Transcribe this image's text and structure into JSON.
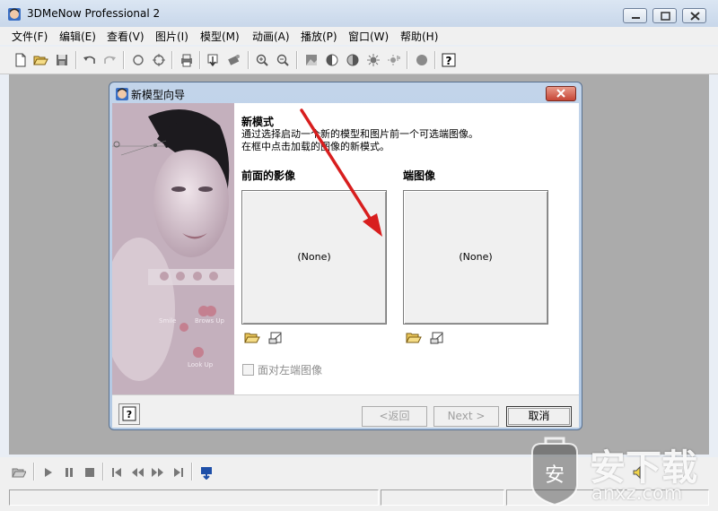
{
  "app": {
    "title": "3DMeNow Professional 2"
  },
  "menu": [
    "文件(F)",
    "编辑(E)",
    "查看(V)",
    "图片(I)",
    "模型(M)",
    "动画(A)",
    "播放(P)",
    "窗口(W)",
    "帮助(H)"
  ],
  "dialog": {
    "title": "新模型向导",
    "heading": "新模式",
    "desc_line1": "通过选择启动一个新的模型和图片前一个可选端图像。",
    "desc_line2": "在框中点击加载的图像的新模式。",
    "front_label": "前面的影像",
    "side_label": "端图像",
    "front_value": "(None)",
    "side_value": "(None)",
    "checkbox_label": "面对左端图像",
    "back_label": "<返回",
    "next_label": "Next >",
    "cancel_label": "取消",
    "photo_labels": {
      "left": "Smile",
      "right": "Brows Up",
      "bottom": "Look Up"
    }
  },
  "watermark": {
    "cn": "安下载",
    "url": "anxz.com",
    "badge": "安"
  },
  "colors": {
    "arrow": "#d81e1e",
    "workspace": "#ababab",
    "title_gradient": "#c8d7ea"
  }
}
